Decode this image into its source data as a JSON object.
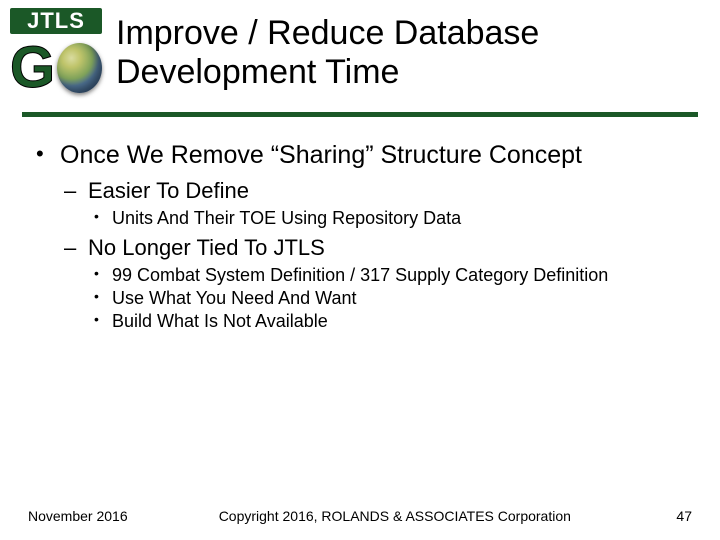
{
  "logo": {
    "top": "JTLS",
    "g": "G"
  },
  "title": "Improve / Reduce Database Development Time",
  "bullets": {
    "lvl1_0": "Once We Remove “Sharing” Structure Concept",
    "lvl2_0": "Easier To Define",
    "lvl3_0_0": "Units And Their TOE Using Repository Data",
    "lvl2_1": "No Longer Tied To JTLS",
    "lvl3_1_0": "99 Combat System Definition / 317 Supply Category Definition",
    "lvl3_1_1": "Use What You Need And Want",
    "lvl3_1_2": "Build What Is Not Available"
  },
  "footer": {
    "date": "November 2016",
    "copyright": "Copyright 2016, ROLANDS & ASSOCIATES Corporation",
    "page": "47"
  }
}
